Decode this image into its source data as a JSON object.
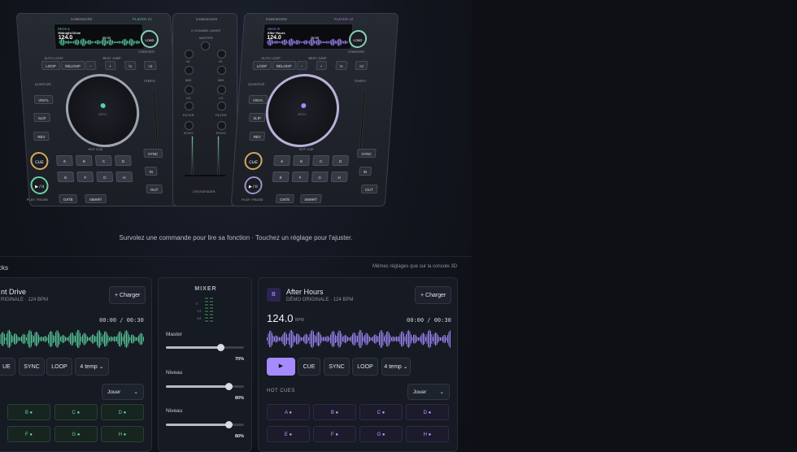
{
  "console": {
    "brand": "DJMEMOIRE",
    "mixer_brand": "DJMEMOIRE",
    "player_left": "PLAYER 01",
    "player_right": "PLAYER 02",
    "deck_a": {
      "label": "DECK A",
      "title": "Midnight Drive",
      "bpm": "124.0",
      "time": "00:00"
    },
    "deck_b": {
      "label": "DECK B",
      "title": "After Hours",
      "bpm": "124.0",
      "time": "00:00"
    },
    "load": "LOAD",
    "charger": "CHARGER",
    "auto_loop": "AUTO LOOP",
    "beat_jump": "BEAT JUMP",
    "loop": "LOOP",
    "reloop": "RELOOP",
    "minus": "−",
    "plus": "+",
    "half": "½",
    "x2": "×2",
    "quantize": "QUANTIZE",
    "vinyl": "VINYL",
    "slip": "SLIP",
    "rev": "REV",
    "tempo": "TEMPO",
    "hot_cue": "HOT CUE",
    "cue": "CUE",
    "play": "▶ / II",
    "play_pause": "PLAY / PAUSE",
    "sync": "SYNC",
    "in": "IN",
    "out": "OUT",
    "gate": "GATE",
    "smart": "SMART",
    "pads_top": [
      "A",
      "B",
      "C",
      "D"
    ],
    "pads_bottom": [
      "E",
      "F",
      "G",
      "H"
    ],
    "mixer_title": "2 CHANNEL MIXER",
    "master": "MASTER",
    "hi": "HI",
    "mid": "MID",
    "lo": "LO",
    "filter": "FILTER",
    "echo": "ECHO",
    "crossfader": "CROSSFADER"
  },
  "hint": "Survolez une commande pour lire sa fonction · Touchez un réglage pour l'ajuster.",
  "section": {
    "title": "cks",
    "note": "Mêmes réglages que sur la console 3D"
  },
  "deck_left": {
    "title": "nt Drive",
    "subtitle": "RIGINALE · 124 BPM",
    "load_button": "+ Charger",
    "time": "00:00 / 00:30",
    "controls": [
      "UE",
      "SYNC",
      "LOOP"
    ],
    "loop_select": "4 temp",
    "mode_select": "Jouer",
    "cues": [
      "B",
      "C",
      "D",
      "F",
      "G",
      "H"
    ],
    "accent": "#6ad0a0"
  },
  "mixer": {
    "title": "MIXER",
    "meter_labels": [
      "0",
      "-12",
      "-24"
    ],
    "master_label": "Master",
    "master_value": "70%",
    "master_level": 0.7,
    "level1_label": "Niveau",
    "level1_value": "80%",
    "level1_level": 0.8,
    "level2_label": "Niveau",
    "level2_value": "80%",
    "level2_level": 0.8
  },
  "deck_right": {
    "badge": "B",
    "title": "After Hours",
    "subtitle": "DÉMO ORIGINALE · 124 BPM",
    "load_button": "+ Charger",
    "bpm": "124.0",
    "bpm_unit": "BPM",
    "time": "00:00 / 00:30",
    "play_icon": "▶",
    "controls": [
      "CUE",
      "SYNC",
      "LOOP"
    ],
    "loop_select": "4 temp",
    "hot_cues_label": "HOT CUES",
    "mode_select": "Jouer",
    "cues": [
      "A",
      "B",
      "C",
      "D",
      "E",
      "F",
      "G",
      "H"
    ],
    "accent": "#a58bff"
  }
}
